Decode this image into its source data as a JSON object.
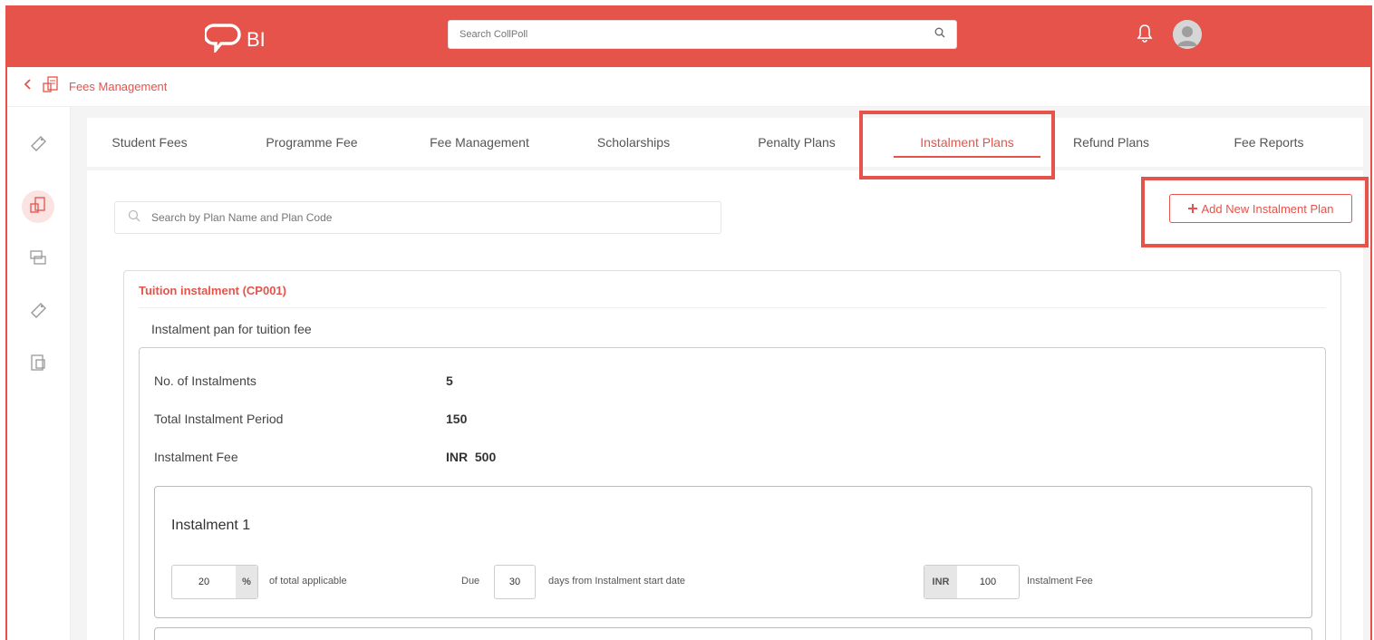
{
  "app": {
    "logo_text": "BI",
    "search_placeholder": "Search CollPoll"
  },
  "breadcrumb": {
    "label": "Fees Management"
  },
  "tabs": [
    {
      "label": "Student Fees"
    },
    {
      "label": "Programme Fee"
    },
    {
      "label": "Fee Management"
    },
    {
      "label": "Scholarships"
    },
    {
      "label": "Penalty Plans"
    },
    {
      "label": "Instalment Plans",
      "active": true
    },
    {
      "label": "Refund Plans"
    },
    {
      "label": "Fee Reports"
    }
  ],
  "toolbar": {
    "search_placeholder": "Search by Plan Name and Plan Code",
    "add_button_label": "Add New Instalment Plan"
  },
  "plan": {
    "title": "Tuition instalment (CP001)",
    "description": "Instalment pan for tuition fee",
    "details": [
      {
        "label": "No. of Instalments",
        "value": "5"
      },
      {
        "label": "Total Instalment Period",
        "value": "150"
      },
      {
        "label": "Instalment Fee",
        "value": "INR  500"
      }
    ],
    "instalments": [
      {
        "title": "Instalment 1",
        "percent": "20",
        "percent_symbol": "%",
        "percent_text": "of total applicable",
        "due_label": "Due",
        "due_days": "30",
        "due_text": "days from Instalment start date",
        "currency": "INR",
        "fee": "100",
        "fee_text": "Instalment Fee"
      }
    ]
  },
  "colors": {
    "brand": "#e5534b",
    "background": "#f4f4f4"
  }
}
